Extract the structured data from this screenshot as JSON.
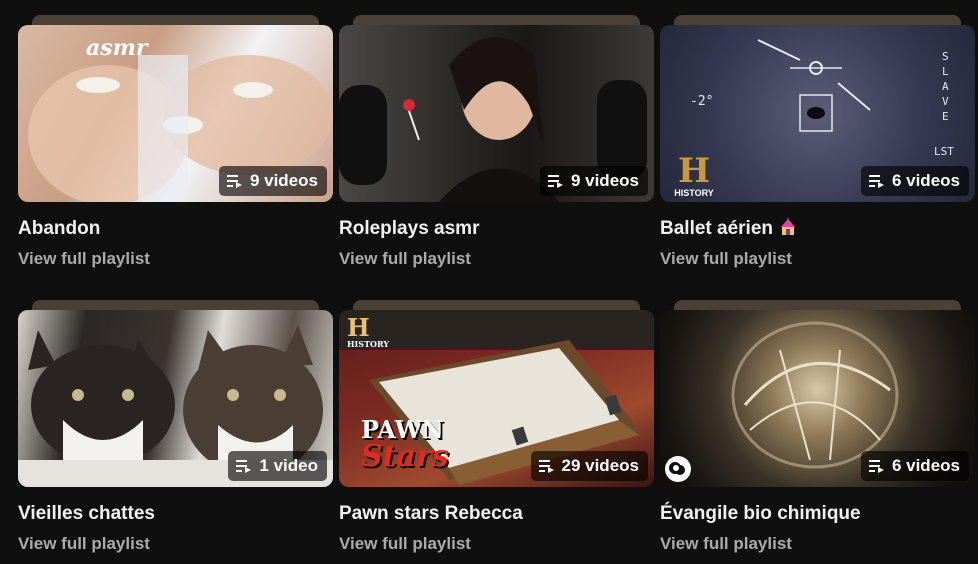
{
  "playlists": [
    {
      "title": "Abandon",
      "count": "9 videos",
      "link": "View full playlist",
      "thumb_text": "asmr"
    },
    {
      "title": "Roleplays asmr",
      "count": "9 videos",
      "link": "View full playlist"
    },
    {
      "title": "Ballet aérien",
      "count": "6 videos",
      "link": "View full playlist",
      "thumb_text": "HISTORY"
    },
    {
      "title": "Vieilles chattes",
      "count": "1 video",
      "link": "View full playlist"
    },
    {
      "title": "Pawn stars Rebecca",
      "count": "29 videos",
      "link": "View full playlist",
      "thumb_text_1": "PAWN",
      "thumb_text_2": "Stars",
      "thumb_text_3": "HISTORY"
    },
    {
      "title": "Évangile bio chimique",
      "count": "6 videos",
      "link": "View full playlist"
    }
  ],
  "colors": {
    "background": "#0f0f0f",
    "title": "#f1f1f1",
    "link": "#aaaaaa"
  },
  "icons": {
    "badge": "playlist-icon",
    "title_emoji": "circus-tent-emoji"
  }
}
